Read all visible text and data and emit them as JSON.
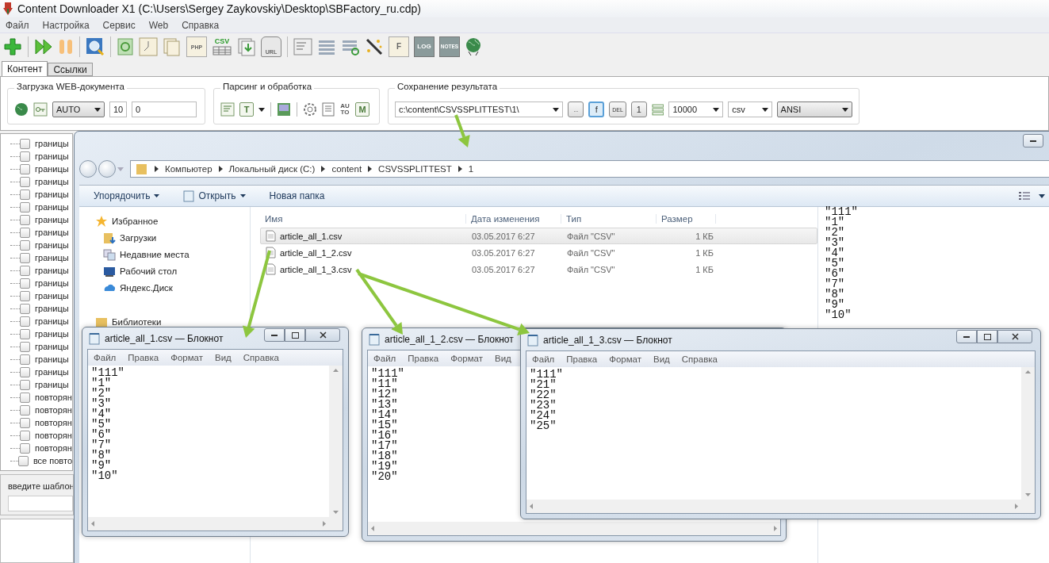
{
  "app": {
    "title": "Content Downloader X1 (C:\\Users\\Sergey Zaykovskiy\\Desktop\\SBFactory_ru.cdp)",
    "menu": [
      "Файл",
      "Настройка",
      "Сервис",
      "Web",
      "Справка"
    ],
    "toolbar": [
      {
        "kind": "add"
      },
      {
        "kind": "separator"
      },
      {
        "kind": "play"
      },
      {
        "kind": "pause"
      },
      {
        "kind": "separator"
      },
      {
        "kind": "search"
      },
      {
        "kind": "separator"
      },
      {
        "kind": "refresh"
      },
      {
        "kind": "clock"
      },
      {
        "kind": "pages"
      },
      {
        "kind": "label",
        "label": "PHP"
      },
      {
        "kind": "csv",
        "label": "CSV"
      },
      {
        "kind": "download"
      },
      {
        "kind": "robot",
        "label": "URL"
      },
      {
        "kind": "separator"
      },
      {
        "kind": "form"
      },
      {
        "kind": "list"
      },
      {
        "kind": "list-refresh"
      },
      {
        "kind": "wand"
      },
      {
        "kind": "label",
        "label": "F"
      },
      {
        "kind": "dark",
        "label": "LOG"
      },
      {
        "kind": "dark",
        "label": "NOTES"
      },
      {
        "kind": "globe"
      }
    ],
    "tabs": [
      {
        "label": "Контент",
        "selected": true
      },
      {
        "label": "Ссылки",
        "selected": false
      }
    ],
    "download_group": {
      "title": "Загрузка WEB-документа",
      "mode": "AUTO",
      "threads": "10",
      "delay": "0"
    },
    "parsing_group": {
      "title": "Парсинг и обработка",
      "icons": [
        {
          "kind": "list"
        },
        {
          "kind": "text",
          "label": "T"
        },
        {
          "kind": "image"
        },
        {
          "kind": "gear"
        },
        {
          "kind": "doc"
        },
        {
          "kind": "plain",
          "label": "AU TO"
        },
        {
          "kind": "text",
          "label": "M"
        }
      ]
    },
    "save_group": {
      "title": "Сохранение результата",
      "path": "c:\\content\\CSVSSPLITTEST\\1\\",
      "buttons": [
        {
          "label": "...",
          "pressed": false
        },
        {
          "label": "f",
          "pressed": true
        },
        {
          "label": "DEL",
          "pressed": false
        },
        {
          "label": "1",
          "pressed": false
        }
      ],
      "limit": "10000",
      "format": "csv",
      "encoding": "ANSI"
    },
    "tree": [
      {
        "label": "границы",
        "checked": false
      },
      {
        "label": "границы",
        "checked": false
      },
      {
        "label": "границы",
        "checked": false
      },
      {
        "label": "границы",
        "checked": false
      },
      {
        "label": "границы",
        "checked": false
      },
      {
        "label": "границы",
        "checked": false
      },
      {
        "label": "границы",
        "checked": false
      },
      {
        "label": "границы",
        "checked": false
      },
      {
        "label": "границы",
        "checked": false
      },
      {
        "label": "границы",
        "checked": false
      },
      {
        "label": "границы",
        "checked": false
      },
      {
        "label": "границы",
        "checked": false
      },
      {
        "label": "границы",
        "checked": false
      },
      {
        "label": "границы",
        "checked": false
      },
      {
        "label": "границы",
        "checked": false
      },
      {
        "label": "границы",
        "checked": false
      },
      {
        "label": "границы",
        "checked": false
      },
      {
        "label": "границы",
        "checked": false
      },
      {
        "label": "границы",
        "checked": false
      },
      {
        "label": "границы",
        "checked": false
      },
      {
        "label": "повторян",
        "checked": false
      },
      {
        "label": "повторян",
        "checked": false
      },
      {
        "label": "повторян",
        "checked": false
      },
      {
        "label": "повторян",
        "checked": false
      },
      {
        "label": "повторян",
        "checked": false
      },
      {
        "label": "все повто",
        "checked": false
      }
    ],
    "template_label": "введите шаблон"
  },
  "explorer": {
    "breadcrumb": [
      "Компьютер",
      "Локальный диск (C:)",
      "content",
      "CSVSSPLITTEST",
      "1"
    ],
    "commands": [
      {
        "label": "Упорядочить",
        "kind": "menu"
      },
      {
        "label": "Открыть",
        "kind": "open"
      },
      {
        "label": "Новая папка",
        "kind": "plain"
      }
    ],
    "nav": [
      {
        "label": "Избранное",
        "kind": "star"
      },
      {
        "label": "Загрузки",
        "kind": "downloads"
      },
      {
        "label": "Недавние места",
        "kind": "recent"
      },
      {
        "label": "Рабочий стол",
        "kind": "desktop"
      },
      {
        "label": "Яндекс.Диск",
        "kind": "cloud"
      },
      {
        "label": "Библиотеки",
        "kind": "library"
      }
    ],
    "columns": [
      "Имя",
      "Дата изменения",
      "Тип",
      "Размер"
    ],
    "rows": [
      {
        "name": "article_all_1.csv",
        "date": "03.05.2017 6:27",
        "type": "Файл \"CSV\"",
        "size": "1 КБ",
        "selected": true
      },
      {
        "name": "article_all_1_2.csv",
        "date": "03.05.2017 6:27",
        "type": "Файл \"CSV\"",
        "size": "1 КБ",
        "selected": false
      },
      {
        "name": "article_all_1_3.csv",
        "date": "03.05.2017 6:27",
        "type": "Файл \"CSV\"",
        "size": "1 КБ",
        "selected": false
      }
    ],
    "preview": [
      "\"111\"",
      "\"1\"",
      "\"2\"",
      "\"3\"",
      "\"4\"",
      "\"5\"",
      "\"6\"",
      "\"7\"",
      "\"8\"",
      "\"9\"",
      "\"10\""
    ]
  },
  "notepads": [
    {
      "title": "article_all_1.csv — Блокнот",
      "covered_right": false,
      "menu": [
        "Файл",
        "Правка",
        "Формат",
        "Вид",
        "Справка"
      ],
      "lines": [
        "\"111\"",
        "\"1\"",
        "\"2\"",
        "\"3\"",
        "\"4\"",
        "\"5\"",
        "\"6\"",
        "\"7\"",
        "\"8\"",
        "\"9\"",
        "\"10\""
      ]
    },
    {
      "title": "article_all_1_2.csv — Блокнот",
      "covered_right": true,
      "menu": [
        "Файл",
        "Правка",
        "Формат",
        "Вид"
      ],
      "lines": [
        "\"111\"",
        "\"11\"",
        "\"12\"",
        "\"13\"",
        "\"14\"",
        "\"15\"",
        "\"16\"",
        "\"17\"",
        "\"18\"",
        "\"19\"",
        "\"20\""
      ]
    },
    {
      "title": "article_all_1_3.csv — Блокнот",
      "covered_right": false,
      "menu": [
        "Файл",
        "Правка",
        "Формат",
        "Вид",
        "Справка"
      ],
      "lines": [
        "\"111\"",
        "\"21\"",
        "\"22\"",
        "\"23\"",
        "\"24\"",
        "\"25\""
      ]
    }
  ]
}
